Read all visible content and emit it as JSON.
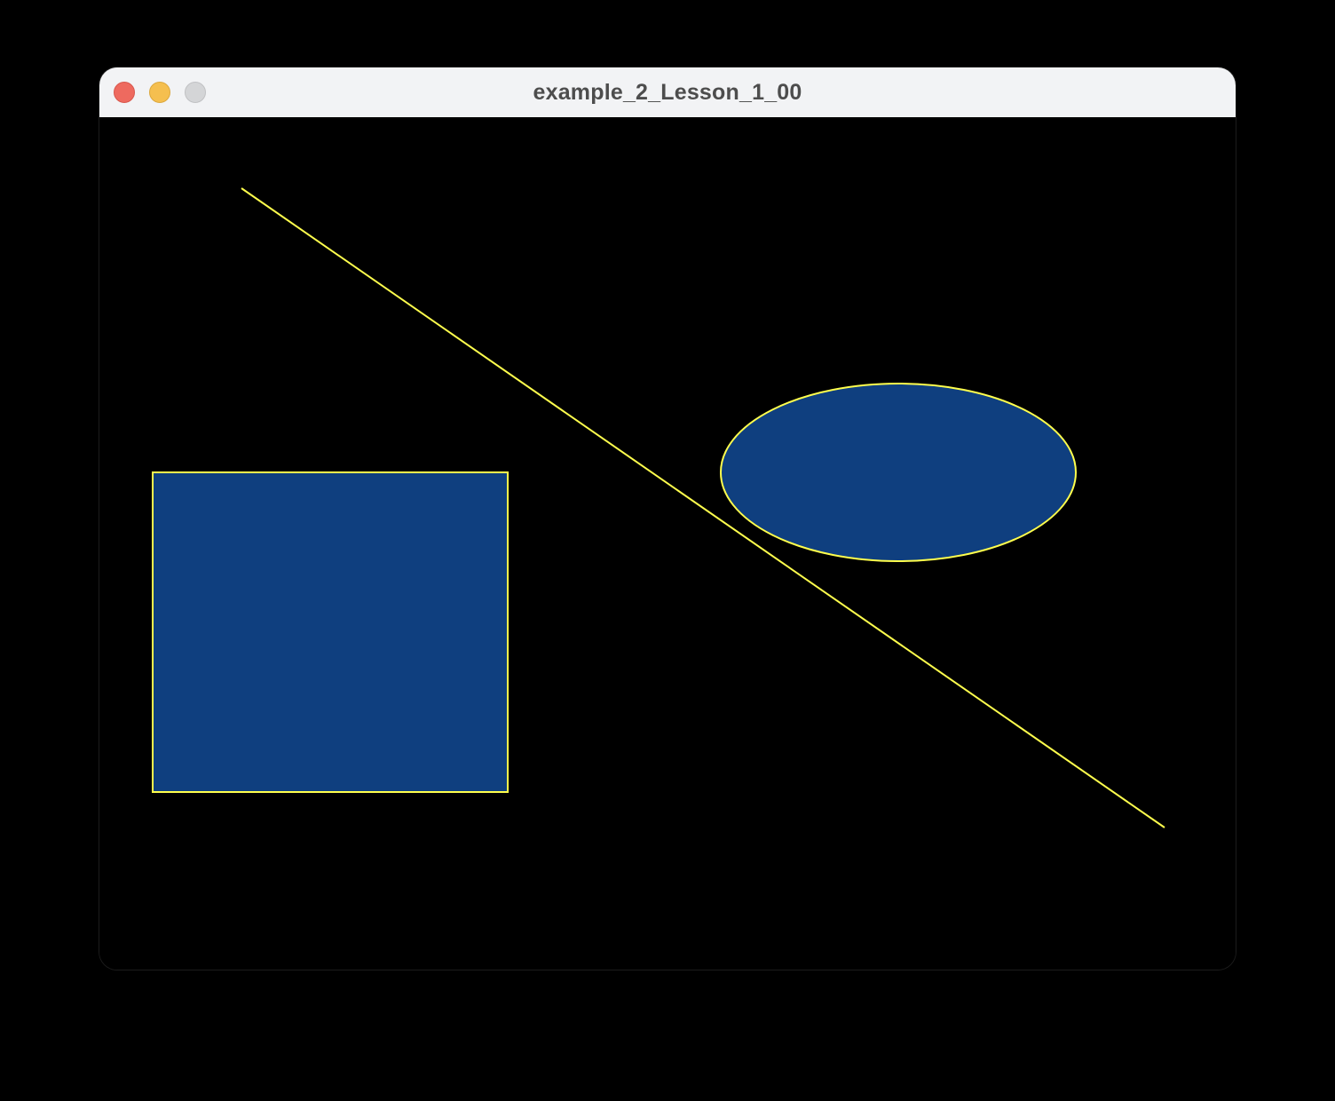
{
  "window": {
    "title": "example_2_Lesson_1_00"
  },
  "colors": {
    "background": "#000000",
    "stroke": "#ffff4d",
    "fill": "#0f3f7f",
    "titlebar": "#f2f3f5",
    "close": "#ee6a5f",
    "minimize": "#f5bf4f",
    "zoom": "#d4d5d7"
  },
  "icons": {
    "close": "close-button-icon",
    "minimize": "minimize-button-icon",
    "zoom": "zoom-button-icon"
  }
}
